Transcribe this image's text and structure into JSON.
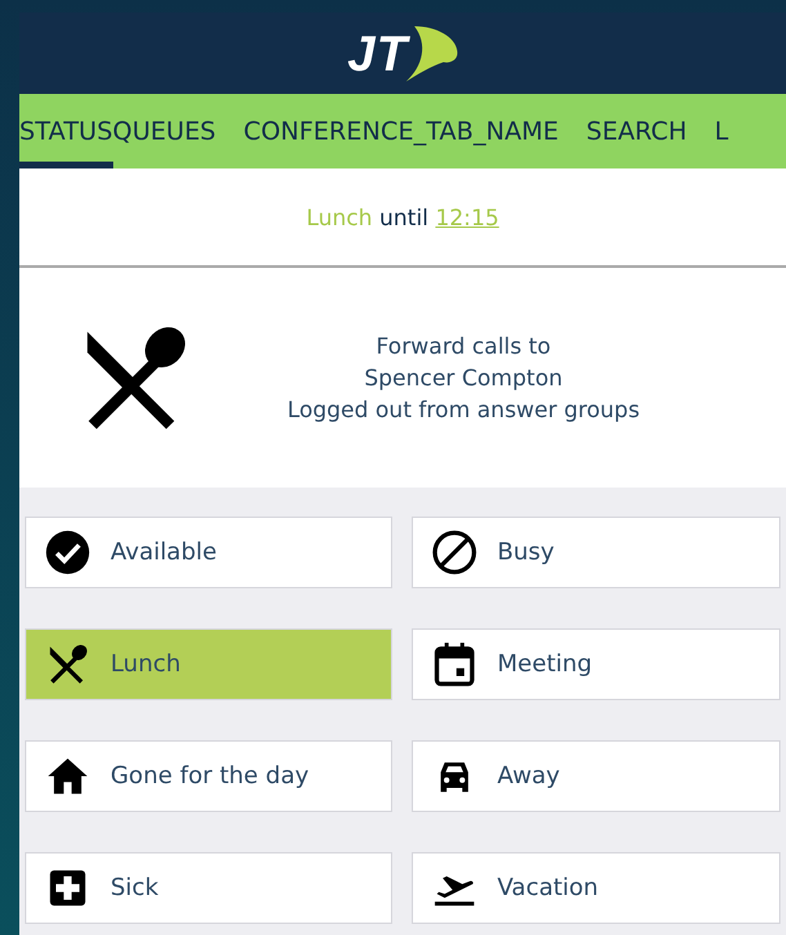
{
  "header": {
    "logo": "JT"
  },
  "tabs": [
    {
      "label": "STATUS",
      "selected": true
    },
    {
      "label": "QUEUES",
      "selected": false
    },
    {
      "label": "CONFERENCE_TAB_NAME",
      "selected": false
    },
    {
      "label": "SEARCH",
      "selected": false
    },
    {
      "label": "L",
      "selected": false
    }
  ],
  "status_line": {
    "status": "Lunch",
    "connector": "until",
    "time": "12:15"
  },
  "info": {
    "kind": "lunch",
    "lines": [
      "Forward calls to",
      "Spencer Compton",
      "Logged out from answer groups"
    ]
  },
  "statuses": [
    {
      "label": "Available",
      "kind": "available",
      "selected": false
    },
    {
      "label": "Busy",
      "kind": "busy",
      "selected": false
    },
    {
      "label": "Lunch",
      "kind": "lunch",
      "selected": true
    },
    {
      "label": "Meeting",
      "kind": "meeting",
      "selected": false
    },
    {
      "label": "Gone for the day",
      "kind": "home",
      "selected": false
    },
    {
      "label": "Away",
      "kind": "away",
      "selected": false
    },
    {
      "label": "Sick",
      "kind": "sick",
      "selected": false
    },
    {
      "label": "Vacation",
      "kind": "vacation",
      "selected": false
    }
  ]
}
